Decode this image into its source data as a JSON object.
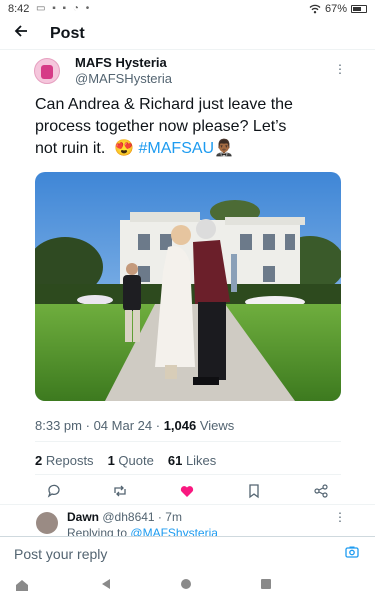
{
  "status_bar": {
    "time": "8:42",
    "battery": "67%",
    "battery_level": 0.67
  },
  "header": {
    "title": "Post"
  },
  "post": {
    "author_name": "MAFS Hysteria",
    "author_handle": "@MAFSHysteria",
    "text_line1": "Can Andrea & Richard just leave the",
    "text_line2": "process together now please? Let’s",
    "text_line3": "not ruin it.",
    "emoji1": "😍",
    "hashtag": "#MAFSAU",
    "emoji2": "🤵🏾‍♂️",
    "time": "8:33 pm",
    "date": "04 Mar 24",
    "views_count": "1,046",
    "views_label": "Views",
    "reposts_count": "2",
    "reposts_label": "Reposts",
    "quotes_count": "1",
    "quotes_label": "Quote",
    "likes_count": "61",
    "likes_label": "Likes"
  },
  "reply_preview": {
    "name": "Dawn",
    "handle": "@dh8641",
    "age": "7m",
    "replying_to_label": "Replying to",
    "replying_to_handle": "@MAFShysteria"
  },
  "reply_bar": {
    "placeholder": "Post your reply"
  },
  "colors": {
    "accent": "#1d9bf0",
    "like": "#f91880",
    "muted": "#536471"
  },
  "icons": [
    "back-arrow-icon",
    "more-icon",
    "reply-icon",
    "repost-icon",
    "like-icon",
    "bookmark-icon",
    "share-icon",
    "camera-icon",
    "wifi-icon",
    "battery-icon"
  ]
}
